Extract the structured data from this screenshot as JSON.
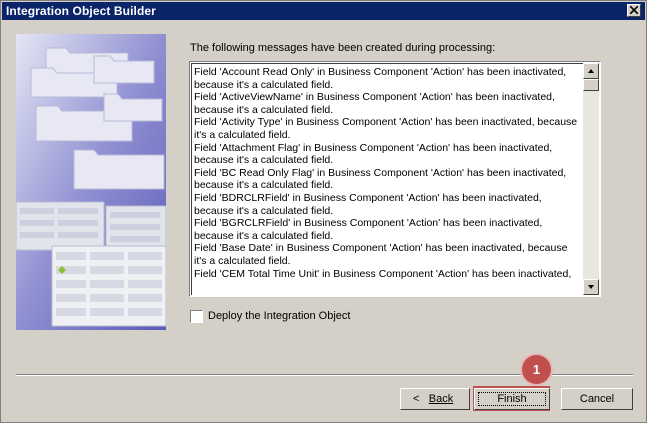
{
  "window": {
    "title": "Integration Object Builder"
  },
  "main": {
    "intro_label": "The following messages have been created during processing:",
    "messages": "Field 'Account Read Only' in Business Component 'Action' has been inactivated,\nbecause it's a calculated field.\nField 'ActiveViewName' in Business Component 'Action' has been inactivated,\nbecause it's a calculated field.\nField 'Activity Type' in Business Component 'Action' has been inactivated, because\nit's a calculated field.\nField 'Attachment Flag' in Business Component 'Action' has been inactivated,\nbecause it's a calculated field.\nField 'BC Read Only Flag' in Business Component 'Action' has been inactivated,\nbecause it's a calculated field.\nField 'BDRCLRField' in Business Component 'Action' has been inactivated,\nbecause it's a calculated field.\nField 'BGRCLRField' in Business Component 'Action' has been inactivated,\nbecause it's a calculated field.\nField 'Base Date' in Business Component 'Action' has been inactivated, because\nit's a calculated field.\nField 'CEM Total Time Unit' in Business Component 'Action' has been inactivated,",
    "deploy_label": "Deploy the Integration Object",
    "deploy_checked": false
  },
  "buttons": {
    "back_label": "Back",
    "finish_label": "Finish",
    "cancel_label": "Cancel"
  },
  "annotation": {
    "step_number": "1",
    "color": "#c0504d"
  },
  "icons": {
    "close": "close-icon",
    "scroll_up": "arrow-up-icon",
    "scroll_down": "arrow-down-icon",
    "back_arrow": "arrow-left-icon"
  }
}
